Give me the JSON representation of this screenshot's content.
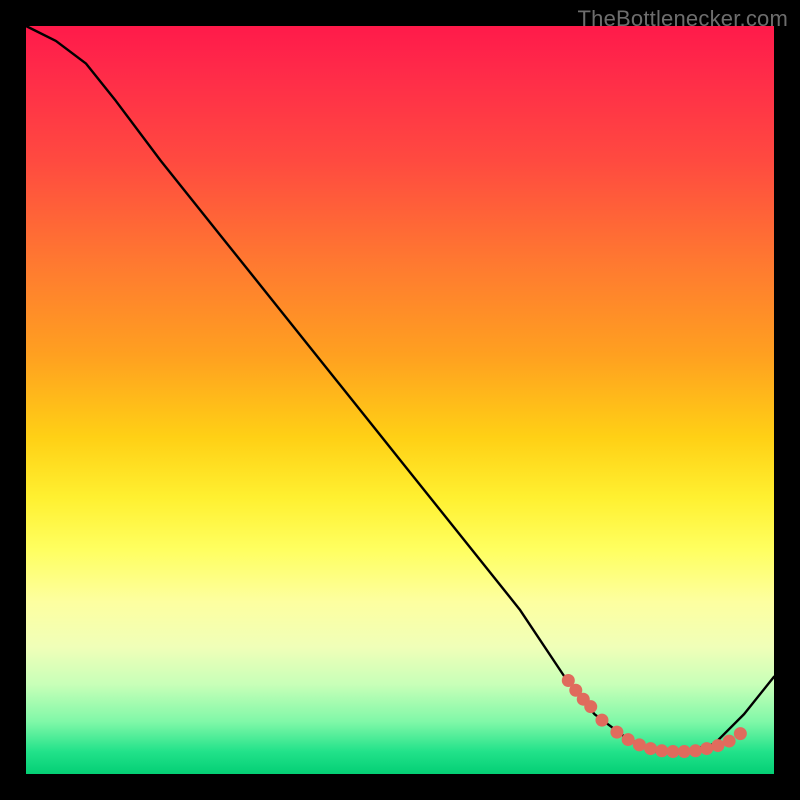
{
  "attribution": "TheBottlenecker.com",
  "chart_data": {
    "type": "line",
    "title": "",
    "xlabel": "",
    "ylabel": "",
    "xlim": [
      0,
      100
    ],
    "ylim": [
      0,
      100
    ],
    "series": [
      {
        "name": "curve",
        "x": [
          0,
          4,
          8,
          12,
          18,
          26,
          34,
          42,
          50,
          58,
          66,
          72,
          76,
          80,
          84,
          88,
          92,
          96,
          100
        ],
        "values": [
          100,
          98,
          95,
          90,
          82,
          72,
          62,
          52,
          42,
          32,
          22,
          13,
          8,
          5,
          3,
          3,
          4,
          8,
          13
        ]
      }
    ],
    "highlight_points": {
      "name": "dots",
      "x": [
        72.5,
        73.5,
        74.5,
        75.5,
        77,
        79,
        80.5,
        82,
        83.5,
        85,
        86.5,
        88,
        89.5,
        91,
        92.5,
        94,
        95.5
      ],
      "values": [
        12.5,
        11.2,
        10.0,
        9.0,
        7.2,
        5.6,
        4.6,
        3.9,
        3.4,
        3.1,
        3.0,
        3.0,
        3.1,
        3.4,
        3.8,
        4.4,
        5.4
      ]
    },
    "colors": {
      "curve": "#000000",
      "dots": "#e06b5d"
    }
  }
}
